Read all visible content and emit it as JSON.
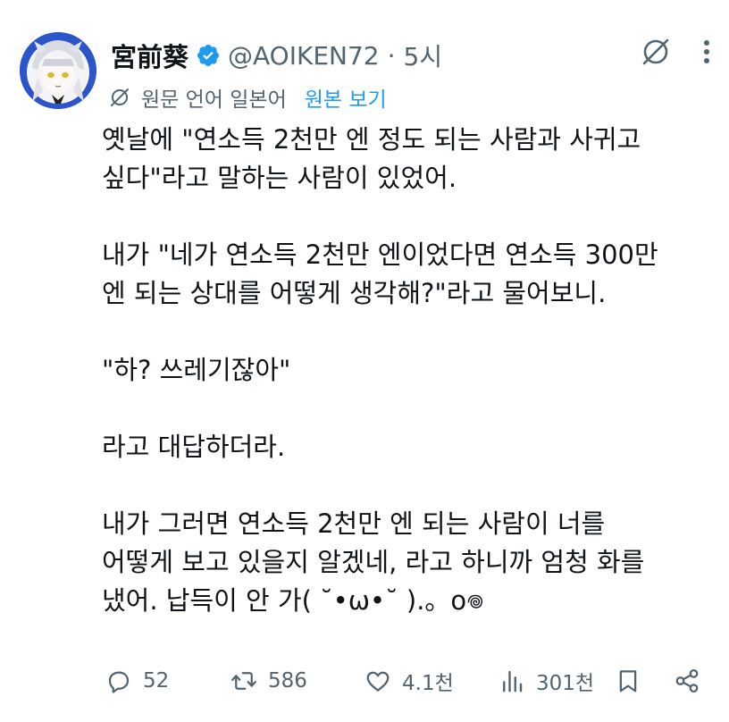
{
  "author": {
    "display_name": "宮前葵",
    "handle": "@AOIKEN72",
    "separator": "·",
    "time": "5시"
  },
  "translation": {
    "note": "원문 언어 일본어",
    "show_original": "원본 보기"
  },
  "body": {
    "paragraphs": [
      "옛날에 \"연소득 2천만 엔 정도 되는 사람과 사귀고\n싶다\"라고 말하는 사람이 있었어.",
      "내가 \"네가 연소득 2천만 엔이었다면 연소득 300만\n엔 되는 상대를 어떻게 생각해?\"라고 물어보니.",
      "\"하? 쓰레기잖아\"",
      "라고 대답하더라.",
      "내가 그러면 연소득 2천만 엔 되는 사람이 너를\n어떻게 보고 있을지 알겠네, 라고 하니까 엄청 화를\n냈어. 납득이 안 가( ˘•ω•˘ ).。o𖦹"
    ]
  },
  "actions": {
    "replies": "52",
    "reposts": "586",
    "likes": "4.1천",
    "views": "301천"
  },
  "colors": {
    "text": "#0f1419",
    "secondary": "#536471",
    "link": "#1d9bf0",
    "verified": "#1d9bf0",
    "avatar_bg": "#2b55c9"
  }
}
